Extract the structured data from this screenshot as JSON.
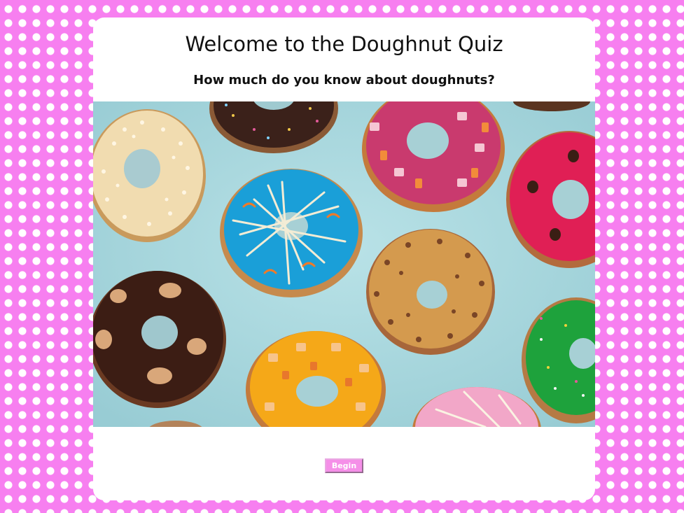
{
  "quiz": {
    "title": "Welcome to the Doughnut Quiz",
    "subtitle": "How much do you know about doughnuts?",
    "begin_label": "Begin"
  },
  "hero_image": {
    "subject": "colorful frosted doughnuts on light blue background",
    "background_color": "#a8d8df"
  },
  "theme": {
    "page_background": "#f77ff0",
    "polka_dot_color": "#ffffff",
    "button_color": "#f58fe8"
  }
}
